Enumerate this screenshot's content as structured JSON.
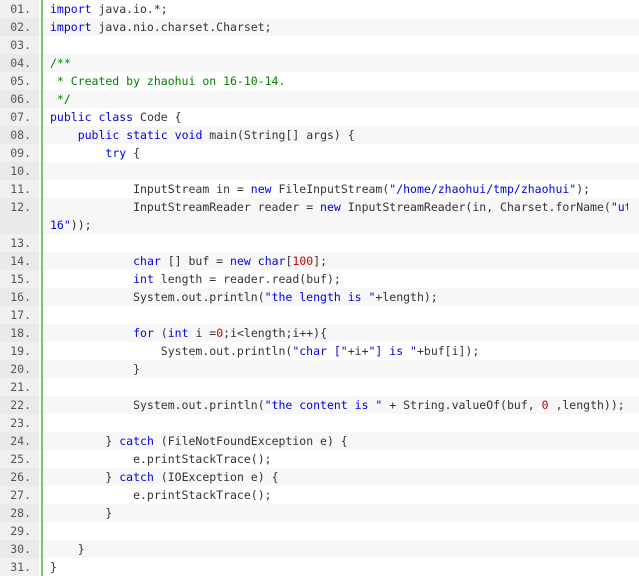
{
  "code_view": {
    "lines": [
      {
        "n": "01.",
        "segments": [
          {
            "t": "import",
            "c": "kw"
          },
          {
            "t": " java.io.*;",
            "c": "txt"
          }
        ]
      },
      {
        "n": "02.",
        "segments": [
          {
            "t": "import",
            "c": "kw"
          },
          {
            "t": " java.nio.charset.Charset;",
            "c": "txt"
          }
        ]
      },
      {
        "n": "03.",
        "segments": []
      },
      {
        "n": "04.",
        "segments": [
          {
            "t": "/**",
            "c": "cm"
          }
        ]
      },
      {
        "n": "05.",
        "segments": [
          {
            "t": " * Created by zhaohui on 16-10-14.",
            "c": "cm"
          }
        ]
      },
      {
        "n": "06.",
        "segments": [
          {
            "t": " */",
            "c": "cm"
          }
        ]
      },
      {
        "n": "07.",
        "segments": [
          {
            "t": "public",
            "c": "kw"
          },
          {
            "t": " ",
            "c": "txt"
          },
          {
            "t": "class",
            "c": "kw"
          },
          {
            "t": " Code {",
            "c": "txt"
          }
        ]
      },
      {
        "n": "08.",
        "segments": [
          {
            "t": "    ",
            "c": "txt"
          },
          {
            "t": "public",
            "c": "kw"
          },
          {
            "t": " ",
            "c": "txt"
          },
          {
            "t": "static",
            "c": "kw"
          },
          {
            "t": " ",
            "c": "txt"
          },
          {
            "t": "void",
            "c": "kw"
          },
          {
            "t": " main(String[] args) {",
            "c": "txt"
          }
        ]
      },
      {
        "n": "09.",
        "segments": [
          {
            "t": "        ",
            "c": "txt"
          },
          {
            "t": "try",
            "c": "kw"
          },
          {
            "t": " {",
            "c": "txt"
          }
        ]
      },
      {
        "n": "10.",
        "segments": []
      },
      {
        "n": "11.",
        "segments": [
          {
            "t": "            InputStream in = ",
            "c": "txt"
          },
          {
            "t": "new",
            "c": "kw"
          },
          {
            "t": " FileInputStream(",
            "c": "txt"
          },
          {
            "t": "\"/home/zhaohui/tmp/zhaohui\"",
            "c": "str"
          },
          {
            "t": ");",
            "c": "txt"
          }
        ]
      },
      {
        "n": "12.",
        "wrap": true,
        "segments": [
          {
            "t": "            InputStreamReader reader = ",
            "c": "txt"
          },
          {
            "t": "new",
            "c": "kw"
          },
          {
            "t": " InputStreamReader(in, Charset.forName(",
            "c": "txt"
          },
          {
            "t": "\"utf-",
            "c": "str"
          }
        ],
        "segments2": [
          {
            "t": "16\"",
            "c": "str"
          },
          {
            "t": "));",
            "c": "txt"
          }
        ]
      },
      {
        "n": "13.",
        "segments": []
      },
      {
        "n": "14.",
        "segments": [
          {
            "t": "            ",
            "c": "txt"
          },
          {
            "t": "char",
            "c": "kw"
          },
          {
            "t": " [] buf = ",
            "c": "txt"
          },
          {
            "t": "new",
            "c": "kw"
          },
          {
            "t": " ",
            "c": "txt"
          },
          {
            "t": "char",
            "c": "kw"
          },
          {
            "t": "[",
            "c": "txt"
          },
          {
            "t": "100",
            "c": "num"
          },
          {
            "t": "];",
            "c": "txt"
          }
        ]
      },
      {
        "n": "15.",
        "segments": [
          {
            "t": "            ",
            "c": "txt"
          },
          {
            "t": "int",
            "c": "kw"
          },
          {
            "t": " length = reader.read(buf);",
            "c": "txt"
          }
        ]
      },
      {
        "n": "16.",
        "segments": [
          {
            "t": "            System.out.println(",
            "c": "txt"
          },
          {
            "t": "\"the length is \"",
            "c": "str"
          },
          {
            "t": "+length);",
            "c": "txt"
          }
        ]
      },
      {
        "n": "17.",
        "segments": []
      },
      {
        "n": "18.",
        "segments": [
          {
            "t": "            ",
            "c": "txt"
          },
          {
            "t": "for",
            "c": "kw"
          },
          {
            "t": " (",
            "c": "txt"
          },
          {
            "t": "int",
            "c": "kw"
          },
          {
            "t": " i =",
            "c": "txt"
          },
          {
            "t": "0",
            "c": "num"
          },
          {
            "t": ";i<length;i++){",
            "c": "txt"
          }
        ]
      },
      {
        "n": "19.",
        "segments": [
          {
            "t": "                System.out.println(",
            "c": "txt"
          },
          {
            "t": "\"char [\"",
            "c": "str"
          },
          {
            "t": "+i+",
            "c": "txt"
          },
          {
            "t": "\"] is \"",
            "c": "str"
          },
          {
            "t": "+buf[i]);",
            "c": "txt"
          }
        ]
      },
      {
        "n": "20.",
        "segments": [
          {
            "t": "            }",
            "c": "txt"
          }
        ]
      },
      {
        "n": "21.",
        "segments": []
      },
      {
        "n": "22.",
        "segments": [
          {
            "t": "            System.out.println(",
            "c": "txt"
          },
          {
            "t": "\"the content is \"",
            "c": "str"
          },
          {
            "t": " + String.valueOf(buf, ",
            "c": "txt"
          },
          {
            "t": "0",
            "c": "num"
          },
          {
            "t": " ,length));",
            "c": "txt"
          }
        ]
      },
      {
        "n": "23.",
        "segments": []
      },
      {
        "n": "24.",
        "segments": [
          {
            "t": "        } ",
            "c": "txt"
          },
          {
            "t": "catch",
            "c": "kw"
          },
          {
            "t": " (FileNotFoundException e) {",
            "c": "txt"
          }
        ]
      },
      {
        "n": "25.",
        "segments": [
          {
            "t": "            e.printStackTrace();",
            "c": "txt"
          }
        ]
      },
      {
        "n": "26.",
        "segments": [
          {
            "t": "        } ",
            "c": "txt"
          },
          {
            "t": "catch",
            "c": "kw"
          },
          {
            "t": " (IOException e) {",
            "c": "txt"
          }
        ]
      },
      {
        "n": "27.",
        "segments": [
          {
            "t": "            e.printStackTrace();",
            "c": "txt"
          }
        ]
      },
      {
        "n": "28.",
        "segments": [
          {
            "t": "        }",
            "c": "txt"
          }
        ]
      },
      {
        "n": "29.",
        "segments": []
      },
      {
        "n": "30.",
        "segments": [
          {
            "t": "    }",
            "c": "txt"
          }
        ]
      },
      {
        "n": "31.",
        "segments": [
          {
            "t": "}",
            "c": "txt"
          }
        ]
      }
    ]
  }
}
